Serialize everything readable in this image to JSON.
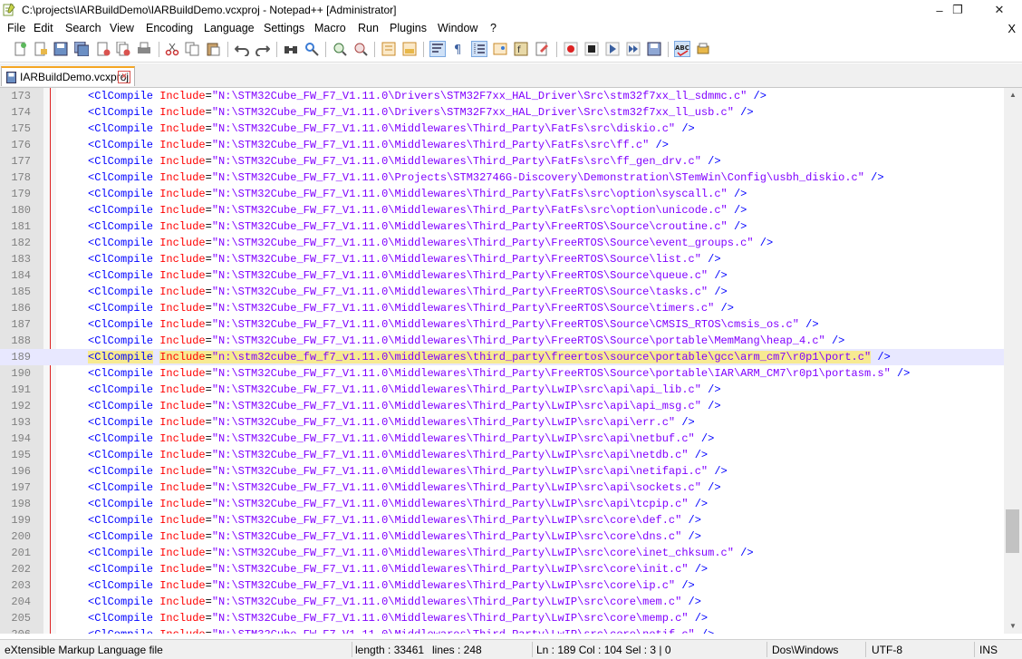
{
  "window": {
    "title": "C:\\projects\\IARBuildDemo\\IARBuildDemo.vcxproj - Notepad++ [Administrator]",
    "minimize_glyph": "–",
    "maximize_glyph": "❐",
    "close_glyph": "✕"
  },
  "menu": {
    "items": [
      "File",
      "Edit",
      "Search",
      "View",
      "Encoding",
      "Language",
      "Settings",
      "Macro",
      "Run",
      "Plugins",
      "Window",
      "?"
    ],
    "close_glyph": "X"
  },
  "toolbar": {
    "icons": [
      "new-file-icon",
      "open-file-icon",
      "save-icon",
      "save-all-icon",
      "close-icon",
      "close-all-icon",
      "print-icon",
      "cut-icon",
      "copy-icon",
      "paste-icon",
      "undo-icon",
      "redo-icon",
      "find-icon",
      "replace-icon",
      "zoom-in-icon",
      "zoom-out-icon",
      "sync-vertical-icon",
      "sync-horizontal-icon",
      "word-wrap-icon",
      "show-all-chars-icon",
      "indent-guide-icon",
      "doc-map-icon",
      "function-list-icon",
      "folder-workspace-icon",
      "record-macro-icon",
      "stop-macro-icon",
      "play-macro-icon",
      "run-macro-multiple-icon",
      "save-macro-icon",
      "spell-check-icon",
      "spell-options-icon"
    ]
  },
  "tab": {
    "label": "IARBuildDemo.vcxproj",
    "close_glyph": "×"
  },
  "editor": {
    "lines": [
      {
        "n": "173",
        "tag": "<ClCompile",
        "attr": "Include",
        "val": "\"N:\\STM32Cube_FW_F7_V1.11.0\\Drivers\\STM32F7xx_HAL_Driver\\Src\\stm32f7xx_ll_sdmmc.c\"",
        "end": " />"
      },
      {
        "n": "174",
        "tag": "<ClCompile",
        "attr": "Include",
        "val": "\"N:\\STM32Cube_FW_F7_V1.11.0\\Drivers\\STM32F7xx_HAL_Driver\\Src\\stm32f7xx_ll_usb.c\"",
        "end": " />"
      },
      {
        "n": "175",
        "tag": "<ClCompile",
        "attr": "Include",
        "val": "\"N:\\STM32Cube_FW_F7_V1.11.0\\Middlewares\\Third_Party\\FatFs\\src\\diskio.c\"",
        "end": " />"
      },
      {
        "n": "176",
        "tag": "<ClCompile",
        "attr": "Include",
        "val": "\"N:\\STM32Cube_FW_F7_V1.11.0\\Middlewares\\Third_Party\\FatFs\\src\\ff.c\"",
        "end": " />"
      },
      {
        "n": "177",
        "tag": "<ClCompile",
        "attr": "Include",
        "val": "\"N:\\STM32Cube_FW_F7_V1.11.0\\Middlewares\\Third_Party\\FatFs\\src\\ff_gen_drv.c\"",
        "end": " />"
      },
      {
        "n": "178",
        "tag": "<ClCompile",
        "attr": "Include",
        "val": "\"N:\\STM32Cube_FW_F7_V1.11.0\\Projects\\STM32746G-Discovery\\Demonstration\\STemWin\\Config\\usbh_diskio.c\"",
        "end": " />"
      },
      {
        "n": "179",
        "tag": "<ClCompile",
        "attr": "Include",
        "val": "\"N:\\STM32Cube_FW_F7_V1.11.0\\Middlewares\\Third_Party\\FatFs\\src\\option\\syscall.c\"",
        "end": " />"
      },
      {
        "n": "180",
        "tag": "<ClCompile",
        "attr": "Include",
        "val": "\"N:\\STM32Cube_FW_F7_V1.11.0\\Middlewares\\Third_Party\\FatFs\\src\\option\\unicode.c\"",
        "end": " />"
      },
      {
        "n": "181",
        "tag": "<ClCompile",
        "attr": "Include",
        "val": "\"N:\\STM32Cube_FW_F7_V1.11.0\\Middlewares\\Third_Party\\FreeRTOS\\Source\\croutine.c\"",
        "end": " />"
      },
      {
        "n": "182",
        "tag": "<ClCompile",
        "attr": "Include",
        "val": "\"N:\\STM32Cube_FW_F7_V1.11.0\\Middlewares\\Third_Party\\FreeRTOS\\Source\\event_groups.c\"",
        "end": " />"
      },
      {
        "n": "183",
        "tag": "<ClCompile",
        "attr": "Include",
        "val": "\"N:\\STM32Cube_FW_F7_V1.11.0\\Middlewares\\Third_Party\\FreeRTOS\\Source\\list.c\"",
        "end": " />"
      },
      {
        "n": "184",
        "tag": "<ClCompile",
        "attr": "Include",
        "val": "\"N:\\STM32Cube_FW_F7_V1.11.0\\Middlewares\\Third_Party\\FreeRTOS\\Source\\queue.c\"",
        "end": " />"
      },
      {
        "n": "185",
        "tag": "<ClCompile",
        "attr": "Include",
        "val": "\"N:\\STM32Cube_FW_F7_V1.11.0\\Middlewares\\Third_Party\\FreeRTOS\\Source\\tasks.c\"",
        "end": " />"
      },
      {
        "n": "186",
        "tag": "<ClCompile",
        "attr": "Include",
        "val": "\"N:\\STM32Cube_FW_F7_V1.11.0\\Middlewares\\Third_Party\\FreeRTOS\\Source\\timers.c\"",
        "end": " />"
      },
      {
        "n": "187",
        "tag": "<ClCompile",
        "attr": "Include",
        "val": "\"N:\\STM32Cube_FW_F7_V1.11.0\\Middlewares\\Third_Party\\FreeRTOS\\Source\\CMSIS_RTOS\\cmsis_os.c\"",
        "end": " />"
      },
      {
        "n": "188",
        "tag": "<ClCompile",
        "attr": "Include",
        "val": "\"N:\\STM32Cube_FW_F7_V1.11.0\\Middlewares\\Third_Party\\FreeRTOS\\Source\\portable\\MemMang\\heap_4.c\"",
        "end": " />"
      },
      {
        "n": "189",
        "tag": "<ClCompile",
        "attr": "Include",
        "val": "\"n:\\stm32cube_fw_f7_v1.11.0\\middlewares\\third_party\\freertos\\source\\portable\\gcc\\arm_cm7\\r0p1\\port.c\"",
        "end": " />",
        "current": true
      },
      {
        "n": "190",
        "tag": "<ClCompile",
        "attr": "Include",
        "val": "\"N:\\STM32Cube_FW_F7_V1.11.0\\Middlewares\\Third_Party\\FreeRTOS\\Source\\portable\\IAR\\ARM_CM7\\r0p1\\portasm.s\"",
        "end": " />"
      },
      {
        "n": "191",
        "tag": "<ClCompile",
        "attr": "Include",
        "val": "\"N:\\STM32Cube_FW_F7_V1.11.0\\Middlewares\\Third_Party\\LwIP\\src\\api\\api_lib.c\"",
        "end": " />"
      },
      {
        "n": "192",
        "tag": "<ClCompile",
        "attr": "Include",
        "val": "\"N:\\STM32Cube_FW_F7_V1.11.0\\Middlewares\\Third_Party\\LwIP\\src\\api\\api_msg.c\"",
        "end": " />"
      },
      {
        "n": "193",
        "tag": "<ClCompile",
        "attr": "Include",
        "val": "\"N:\\STM32Cube_FW_F7_V1.11.0\\Middlewares\\Third_Party\\LwIP\\src\\api\\err.c\"",
        "end": " />"
      },
      {
        "n": "194",
        "tag": "<ClCompile",
        "attr": "Include",
        "val": "\"N:\\STM32Cube_FW_F7_V1.11.0\\Middlewares\\Third_Party\\LwIP\\src\\api\\netbuf.c\"",
        "end": " />"
      },
      {
        "n": "195",
        "tag": "<ClCompile",
        "attr": "Include",
        "val": "\"N:\\STM32Cube_FW_F7_V1.11.0\\Middlewares\\Third_Party\\LwIP\\src\\api\\netdb.c\"",
        "end": " />"
      },
      {
        "n": "196",
        "tag": "<ClCompile",
        "attr": "Include",
        "val": "\"N:\\STM32Cube_FW_F7_V1.11.0\\Middlewares\\Third_Party\\LwIP\\src\\api\\netifapi.c\"",
        "end": " />"
      },
      {
        "n": "197",
        "tag": "<ClCompile",
        "attr": "Include",
        "val": "\"N:\\STM32Cube_FW_F7_V1.11.0\\Middlewares\\Third_Party\\LwIP\\src\\api\\sockets.c\"",
        "end": " />"
      },
      {
        "n": "198",
        "tag": "<ClCompile",
        "attr": "Include",
        "val": "\"N:\\STM32Cube_FW_F7_V1.11.0\\Middlewares\\Third_Party\\LwIP\\src\\api\\tcpip.c\"",
        "end": " />"
      },
      {
        "n": "199",
        "tag": "<ClCompile",
        "attr": "Include",
        "val": "\"N:\\STM32Cube_FW_F7_V1.11.0\\Middlewares\\Third_Party\\LwIP\\src\\core\\def.c\"",
        "end": " />"
      },
      {
        "n": "200",
        "tag": "<ClCompile",
        "attr": "Include",
        "val": "\"N:\\STM32Cube_FW_F7_V1.11.0\\Middlewares\\Third_Party\\LwIP\\src\\core\\dns.c\"",
        "end": " />"
      },
      {
        "n": "201",
        "tag": "<ClCompile",
        "attr": "Include",
        "val": "\"N:\\STM32Cube_FW_F7_V1.11.0\\Middlewares\\Third_Party\\LwIP\\src\\core\\inet_chksum.c\"",
        "end": " />"
      },
      {
        "n": "202",
        "tag": "<ClCompile",
        "attr": "Include",
        "val": "\"N:\\STM32Cube_FW_F7_V1.11.0\\Middlewares\\Third_Party\\LwIP\\src\\core\\init.c\"",
        "end": " />"
      },
      {
        "n": "203",
        "tag": "<ClCompile",
        "attr": "Include",
        "val": "\"N:\\STM32Cube_FW_F7_V1.11.0\\Middlewares\\Third_Party\\LwIP\\src\\core\\ip.c\"",
        "end": " />"
      },
      {
        "n": "204",
        "tag": "<ClCompile",
        "attr": "Include",
        "val": "\"N:\\STM32Cube_FW_F7_V1.11.0\\Middlewares\\Third_Party\\LwIP\\src\\core\\mem.c\"",
        "end": " />"
      },
      {
        "n": "205",
        "tag": "<ClCompile",
        "attr": "Include",
        "val": "\"N:\\STM32Cube_FW_F7_V1.11.0\\Middlewares\\Third_Party\\LwIP\\src\\core\\memp.c\"",
        "end": " />"
      },
      {
        "n": "206",
        "tag": "<ClCompile",
        "attr": "Include",
        "val": "\"N:\\STM32Cube_FW_F7_V1.11.0\\Middlewares\\Third_Party\\LwIP\\src\\core\\netif.c\"",
        "end": " />"
      }
    ]
  },
  "scrollbar": {
    "up_glyph": "▲",
    "down_glyph": "▼"
  },
  "status": {
    "file_type": "eXtensible Markup Language file",
    "length": "length : 33461",
    "lines": "lines : 248",
    "position": "Ln : 189    Col : 104    Sel : 3 | 0",
    "eol": "Dos\\Windows",
    "encoding": "UTF-8",
    "mode": "INS"
  },
  "colors": {
    "tag": "#0000ff",
    "attribute": "#ff0000",
    "value": "#8000ff",
    "current_line": "#e8e8ff",
    "match_highlight": "#f7ea91",
    "tab_accent": "#f5a623"
  }
}
